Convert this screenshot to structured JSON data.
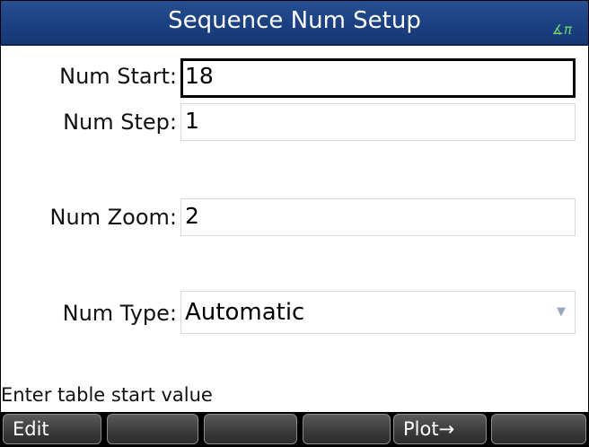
{
  "titlebar": {
    "title": "Sequence Num Setup",
    "angle_mode_icon": "angle-radians-icon",
    "angle_mode_text": "∡π"
  },
  "fields": {
    "num_start": {
      "label": "Num Start:",
      "value": "18"
    },
    "num_step": {
      "label": "Num Step:",
      "value": "1"
    },
    "num_zoom": {
      "label": "Num Zoom:",
      "value": "2"
    },
    "num_type": {
      "label": "Num Type:",
      "value": "Automatic",
      "arrow": "▼"
    }
  },
  "status": {
    "text": "Enter table start value"
  },
  "softkeys": [
    {
      "label": "Edit"
    },
    {
      "label": ""
    },
    {
      "label": ""
    },
    {
      "label": ""
    },
    {
      "label": "Plot→"
    },
    {
      "label": ""
    }
  ],
  "colors": {
    "title_bar": "#1f4689",
    "angle_icon": "#6fd36a",
    "focused_border": "#000000",
    "softkey_bg": "#3c3c3c"
  }
}
